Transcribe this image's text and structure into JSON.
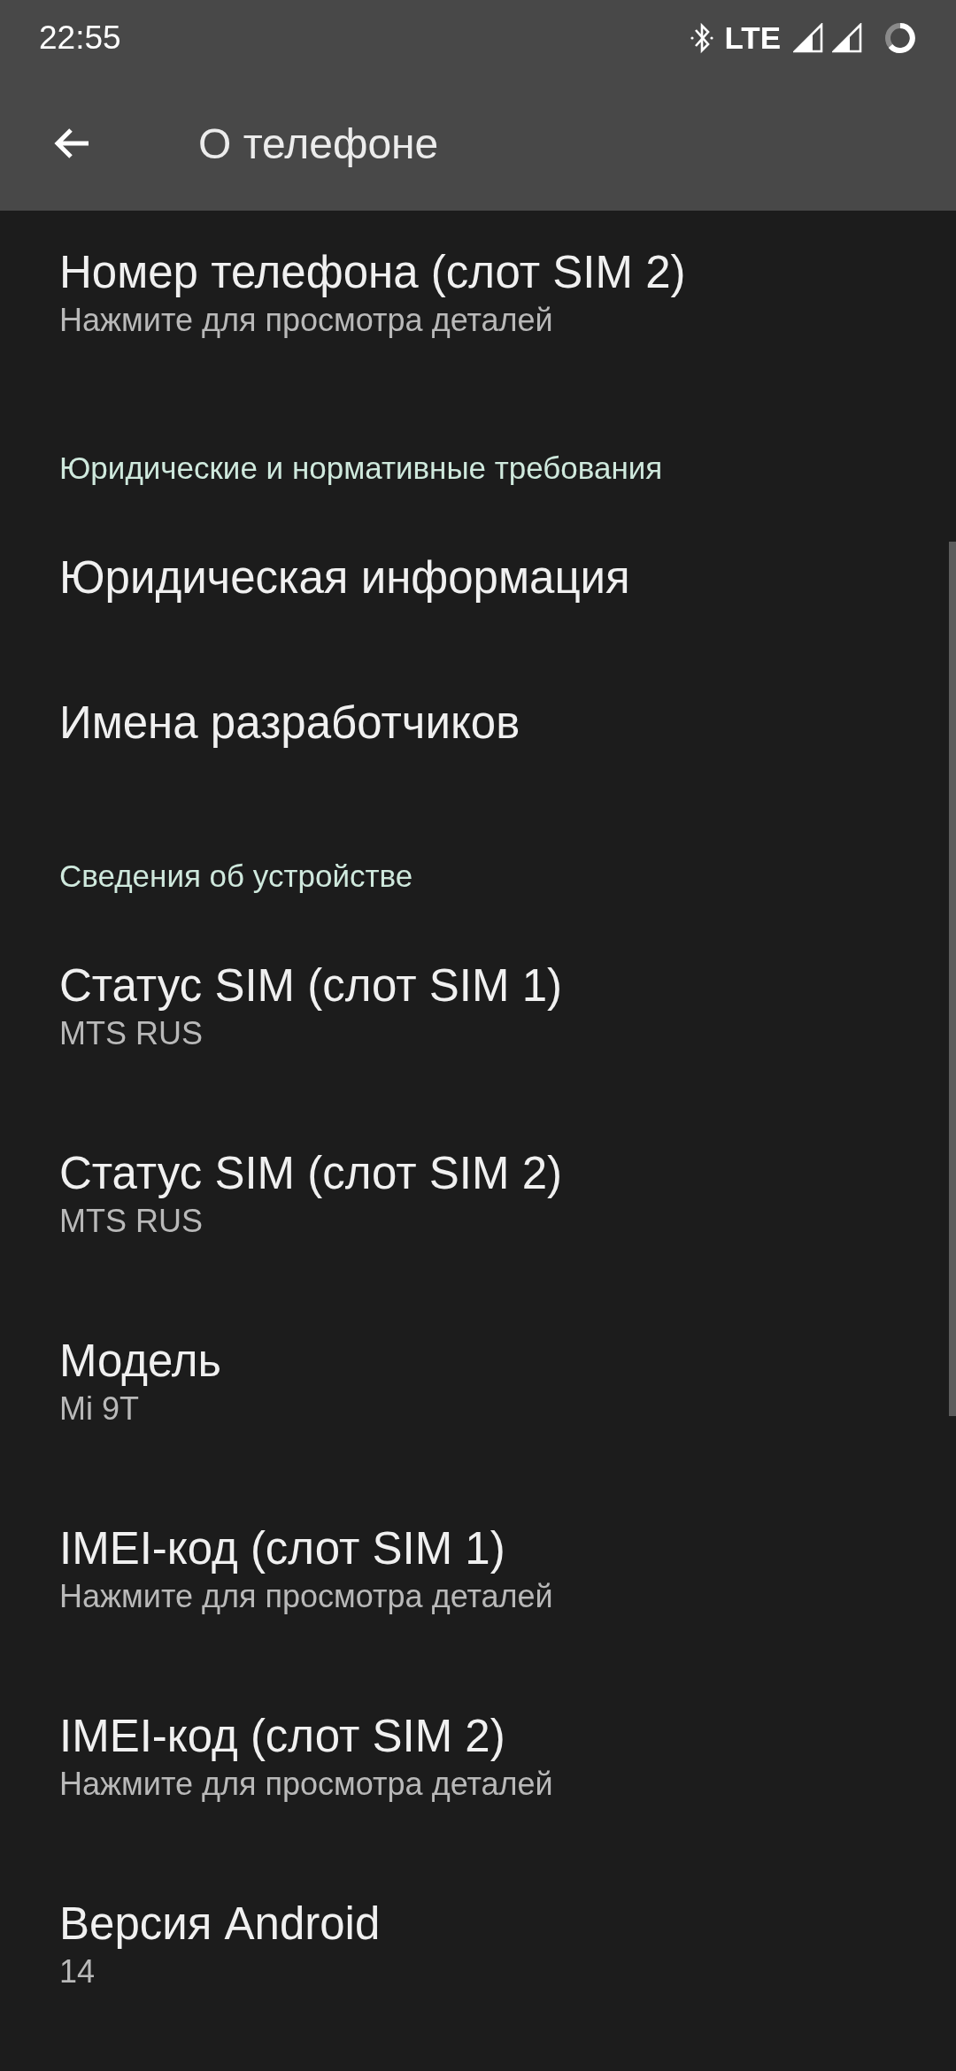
{
  "status_bar": {
    "time": "22:55",
    "network": "LTE"
  },
  "app_bar": {
    "title": "О телефоне"
  },
  "list": [
    {
      "kind": "item",
      "title": "Номер телефона (слот SIM 2)",
      "summary": "Нажмите для просмотра деталей"
    },
    {
      "kind": "header",
      "title": "Юридические и нормативные требования"
    },
    {
      "kind": "item",
      "title": "Юридическая информация"
    },
    {
      "kind": "item",
      "title": "Имена разработчиков"
    },
    {
      "kind": "header",
      "title": "Сведения об устройстве"
    },
    {
      "kind": "item",
      "title": "Статус SIM (слот SIM 1)",
      "summary": "MTS RUS"
    },
    {
      "kind": "item",
      "title": "Статус SIM (слот SIM 2)",
      "summary": "MTS RUS"
    },
    {
      "kind": "item",
      "title": "Модель",
      "summary": "Mi 9T"
    },
    {
      "kind": "item",
      "title": "IMEI-код (слот SIM 1)",
      "summary": "Нажмите для просмотра деталей"
    },
    {
      "kind": "item",
      "title": "IMEI-код (слот SIM 2)",
      "summary": "Нажмите для просмотра деталей"
    },
    {
      "kind": "item",
      "title": "Версия Android",
      "summary": "14"
    }
  ]
}
